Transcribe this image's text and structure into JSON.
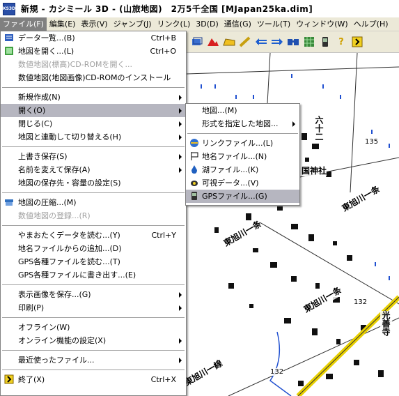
{
  "titlebar": {
    "icon_label": "KS3D",
    "title": "新規 - カシミール 3D - (山旅地図)　2万5千全国 [MJapan25ka.dim]"
  },
  "menubar": {
    "items": [
      {
        "label": "ファイル(F)"
      },
      {
        "label": "編集(E)"
      },
      {
        "label": "表示(V)"
      },
      {
        "label": "ジャンプ(J)"
      },
      {
        "label": "リンク(L)"
      },
      {
        "label": "3D(D)"
      },
      {
        "label": "通信(G)"
      },
      {
        "label": "ツール(T)"
      },
      {
        "label": "ウィンドウ(W)"
      },
      {
        "label": "ヘルプ(H)"
      }
    ]
  },
  "toolbar": {
    "icons": [
      "layers-icon",
      "mountain-icon",
      "cheese-icon",
      "ruler-icon",
      "arrow-left-icon",
      "arrow-right-icon",
      "binoculars-icon",
      "map-grid-icon",
      "gps-icon",
      "help-icon",
      "exit-icon"
    ]
  },
  "file_menu": {
    "items": [
      {
        "label": "データ一覧...(B)",
        "shortcut": "Ctrl+B",
        "icon": "data-list-icon",
        "disabled": false,
        "submenu": false
      },
      {
        "label": "地図を開く...(L)",
        "shortcut": "Ctrl+O",
        "icon": "open-map-icon",
        "disabled": false,
        "submenu": false
      },
      {
        "label": "数値地図(標高)CD-ROMを開く...",
        "shortcut": "",
        "icon": "",
        "disabled": true,
        "submenu": false
      },
      {
        "label": "数値地図(地図画像)CD-ROMのインストール",
        "shortcut": "",
        "icon": "",
        "disabled": false,
        "submenu": false
      },
      {
        "sep": true
      },
      {
        "label": "新規作成(N)",
        "shortcut": "",
        "icon": "",
        "disabled": false,
        "submenu": true
      },
      {
        "label": "開く(O)",
        "shortcut": "",
        "icon": "",
        "disabled": false,
        "submenu": true,
        "highlight": true
      },
      {
        "label": "閉じる(C)",
        "shortcut": "",
        "icon": "",
        "disabled": false,
        "submenu": true
      },
      {
        "label": "地図と連動して切り替える(H)",
        "shortcut": "",
        "icon": "",
        "disabled": false,
        "submenu": true
      },
      {
        "sep": true
      },
      {
        "label": "上書き保存(S)",
        "shortcut": "",
        "icon": "",
        "disabled": false,
        "submenu": true
      },
      {
        "label": "名前を変えて保存(A)",
        "shortcut": "",
        "icon": "",
        "disabled": false,
        "submenu": true
      },
      {
        "label": "地図の保存先・容量の設定(S)",
        "shortcut": "",
        "icon": "",
        "disabled": false,
        "submenu": false
      },
      {
        "sep": true
      },
      {
        "label": "地図の圧縮...(M)",
        "shortcut": "",
        "icon": "compress-icon",
        "disabled": false,
        "submenu": false
      },
      {
        "label": "数値地図の登録...(R)",
        "shortcut": "",
        "icon": "",
        "disabled": true,
        "submenu": false
      },
      {
        "sep": true
      },
      {
        "label": "やまおたくデータを読む...(Y)",
        "shortcut": "Ctrl+Y",
        "icon": "",
        "disabled": false,
        "submenu": false
      },
      {
        "label": "地名ファイルからの追加...(D)",
        "shortcut": "",
        "icon": "",
        "disabled": false,
        "submenu": false
      },
      {
        "label": "GPS各種ファイルを読む...(T)",
        "shortcut": "",
        "icon": "",
        "disabled": false,
        "submenu": false
      },
      {
        "label": "GPS各種ファイルに書き出す...(E)",
        "shortcut": "",
        "icon": "",
        "disabled": false,
        "submenu": false
      },
      {
        "sep": true
      },
      {
        "label": "表示画像を保存...(G)",
        "shortcut": "",
        "icon": "",
        "disabled": false,
        "submenu": true
      },
      {
        "label": "印刷(P)",
        "shortcut": "",
        "icon": "",
        "disabled": false,
        "submenu": true
      },
      {
        "sep": true
      },
      {
        "label": "オフライン(W)",
        "shortcut": "",
        "icon": "",
        "disabled": false,
        "submenu": false
      },
      {
        "label": "オンライン機能の設定(X)",
        "shortcut": "",
        "icon": "",
        "disabled": false,
        "submenu": true
      },
      {
        "sep": true
      },
      {
        "label": "最近使ったファイル...",
        "shortcut": "",
        "icon": "",
        "disabled": false,
        "submenu": true
      },
      {
        "sep": true
      },
      {
        "label": "終了(X)",
        "shortcut": "Ctrl+X",
        "icon": "exit-icon",
        "disabled": false,
        "submenu": false
      }
    ]
  },
  "open_submenu": {
    "items": [
      {
        "label": "地図...(M)",
        "icon": "",
        "submenu": false
      },
      {
        "label": "形式を指定した地図...",
        "icon": "",
        "submenu": true
      },
      {
        "sep": true
      },
      {
        "label": "リンクファイル...(L)",
        "icon": "link-file-icon",
        "submenu": false
      },
      {
        "label": "地名ファイル...(N)",
        "icon": "flag-icon",
        "submenu": false
      },
      {
        "label": "湖ファイル...(K)",
        "icon": "lake-icon",
        "submenu": false
      },
      {
        "label": "可視データ...(V)",
        "icon": "visibility-icon",
        "submenu": false
      },
      {
        "label": "GPSファイル...(G)",
        "icon": "gps-file-icon",
        "submenu": false,
        "highlight": true
      }
    ]
  },
  "map": {
    "labels": [
      {
        "text": "六十二"
      },
      {
        "text": "135"
      },
      {
        "text": "国神社"
      },
      {
        "text": "東旭川一条"
      },
      {
        "text": "東旭川一条"
      },
      {
        "text": "東旭川一条"
      },
      {
        "text": "132"
      },
      {
        "text": "光善寺"
      },
      {
        "text": "東旭川一線"
      },
      {
        "text": "132"
      }
    ]
  }
}
